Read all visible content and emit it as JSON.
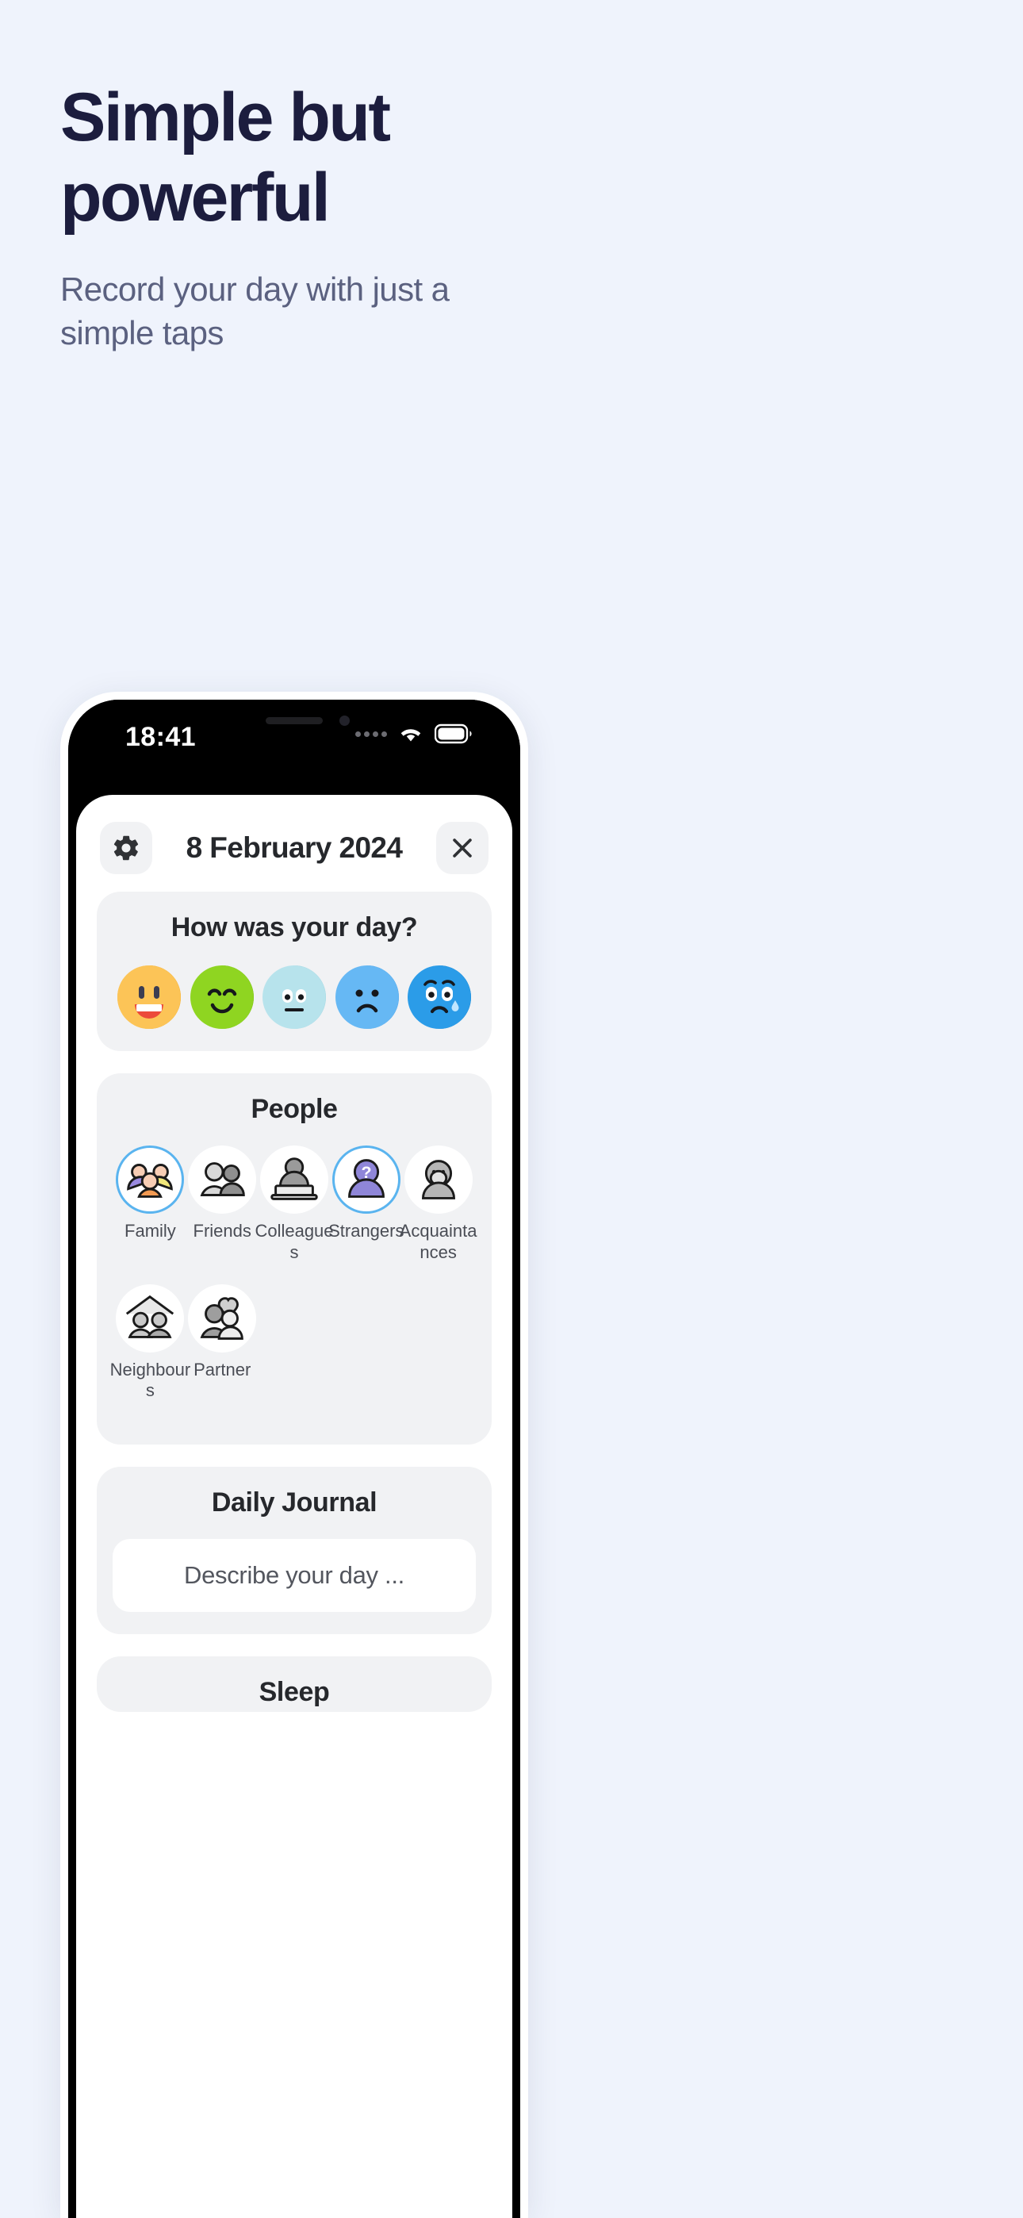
{
  "hero": {
    "title": "Simple but powerful",
    "subtitle": "Record your day with just a simple taps"
  },
  "colors": {
    "page_bg": "#eff3fc",
    "title": "#1c1d3e",
    "subtitle": "#5b6180",
    "card_bg": "#f1f2f4",
    "accent_selected": "#5ab4ef"
  },
  "phone": {
    "status": {
      "time": "18:41",
      "signal_icon": "signal-dots-icon",
      "wifi_icon": "wifi-icon",
      "battery_icon": "battery-icon"
    },
    "header": {
      "settings_icon": "gear-icon",
      "date": "8 February 2024",
      "close_icon": "close-icon"
    },
    "mood": {
      "title": "How was your day?",
      "options": [
        {
          "name": "very-happy",
          "color": "#fcc457",
          "label": "Very happy"
        },
        {
          "name": "happy",
          "color": "#8fd521",
          "label": "Happy"
        },
        {
          "name": "neutral",
          "color": "#b7e3ec",
          "label": "Neutral"
        },
        {
          "name": "sad",
          "color": "#66b8f4",
          "label": "Sad"
        },
        {
          "name": "very-sad",
          "color": "#2b9ce8",
          "label": "Very sad"
        }
      ]
    },
    "people": {
      "title": "People",
      "items": [
        {
          "label": "Family",
          "selected": true
        },
        {
          "label": "Friends",
          "selected": false
        },
        {
          "label": "Colleagues",
          "selected": false
        },
        {
          "label": "Strangers",
          "selected": true
        },
        {
          "label": "Acquaintances",
          "selected": false
        },
        {
          "label": "Neighbours",
          "selected": false
        },
        {
          "label": "Partner",
          "selected": false
        }
      ]
    },
    "journal": {
      "title": "Daily Journal",
      "placeholder": "Describe your day ..."
    }
  }
}
